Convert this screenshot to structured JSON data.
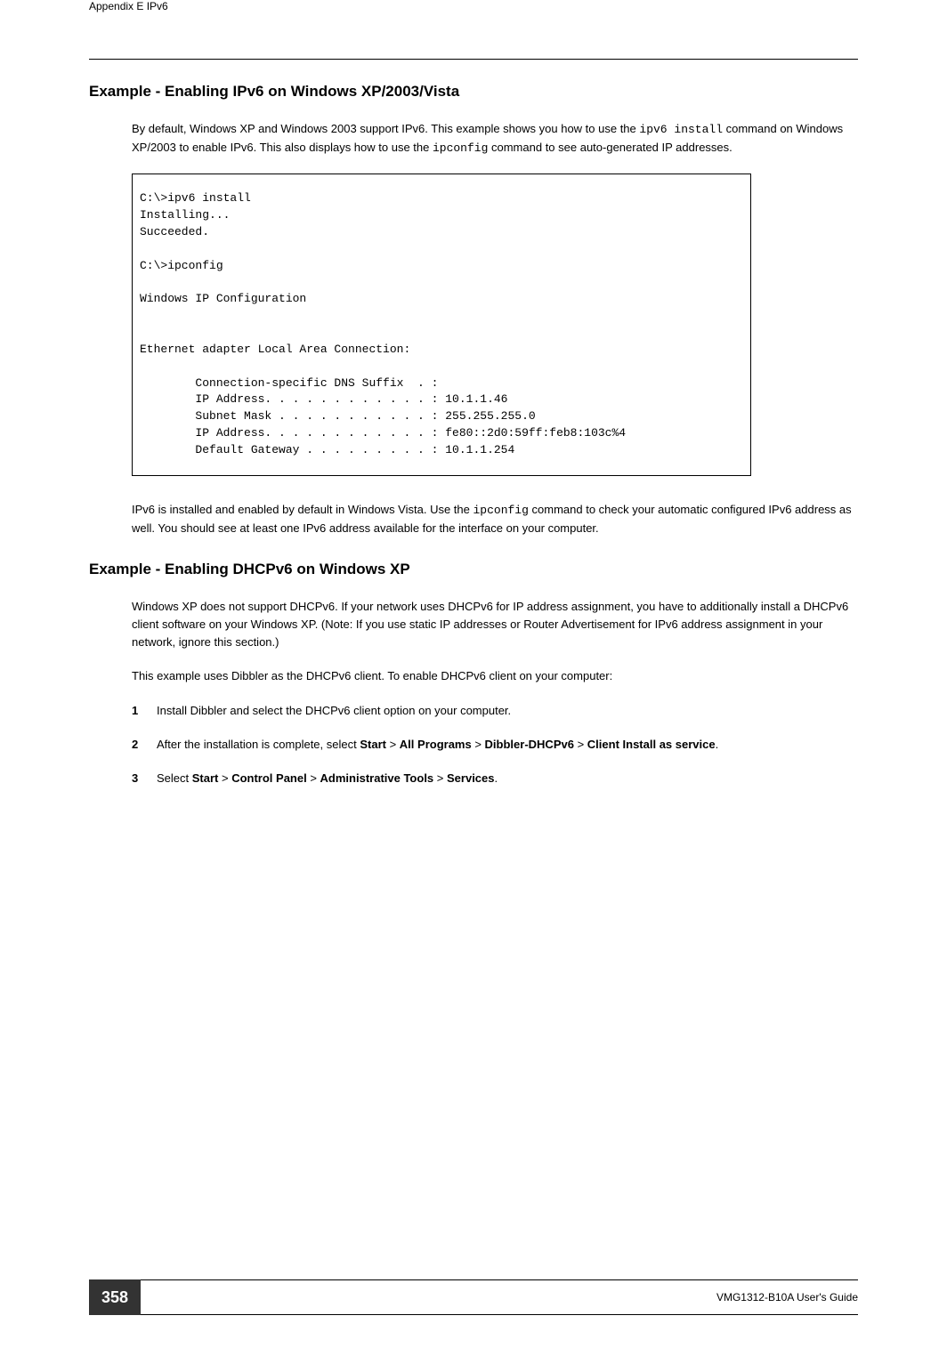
{
  "header": {
    "appendix": "Appendix E IPv6"
  },
  "section1": {
    "heading": "Example - Enabling IPv6 on Windows XP/2003/Vista",
    "para1a": "By default, Windows XP and Windows 2003 support IPv6. This example shows you how to use the ",
    "code1": "ipv6 install",
    "para1b": " command on Windows XP/2003 to enable IPv6. This also displays how to use the ",
    "code2": "ipconfig",
    "para1c": " command to see auto-generated IP addresses.",
    "codebox": "C:\\>ipv6 install\nInstalling...\nSucceeded.\n\nC:\\>ipconfig\n\nWindows IP Configuration\n\n\nEthernet adapter Local Area Connection:\n\n        Connection-specific DNS Suffix  . :\n        IP Address. . . . . . . . . . . . : 10.1.1.46\n        Subnet Mask . . . . . . . . . . . : 255.255.255.0\n        IP Address. . . . . . . . . . . . : fe80::2d0:59ff:feb8:103c%4\n        Default Gateway . . . . . . . . . : 10.1.1.254",
    "para2a": "IPv6 is installed and enabled by default in Windows Vista. Use the ",
    "code3": "ipconfig",
    "para2b": " command to check your automatic configured IPv6 address as well. You should see at least one IPv6 address available for the interface on your computer."
  },
  "section2": {
    "heading": "Example - Enabling DHCPv6 on Windows XP",
    "para1": "Windows XP does not support DHCPv6. If your network uses DHCPv6 for IP address assignment, you have to additionally install a DHCPv6 client software on your Windows XP. (Note: If you use static IP addresses or Router Advertisement for IPv6 address assignment in your network, ignore this section.)",
    "para2": "This example uses Dibbler as the DHCPv6 client. To enable DHCPv6 client on your computer:",
    "step1": {
      "num": "1",
      "text": "Install Dibbler and select the DHCPv6 client option on your computer."
    },
    "step2": {
      "num": "2",
      "text_a": "After the installation is complete, select ",
      "b1": "Start",
      "s1": " > ",
      "b2": "All Programs",
      "s2": " > ",
      "b3": "Dibbler-DHCPv6",
      "s3": " > ",
      "b4": "Client Install as service",
      "s4": "."
    },
    "step3": {
      "num": "3",
      "text_a": "Select ",
      "b1": "Start",
      "s1": " > ",
      "b2": "Control Panel",
      "s2": " > ",
      "b3": "Administrative Tools",
      "s3": " > ",
      "b4": "Services",
      "s4": "."
    }
  },
  "footer": {
    "page": "358",
    "guide": "VMG1312-B10A User's Guide"
  }
}
